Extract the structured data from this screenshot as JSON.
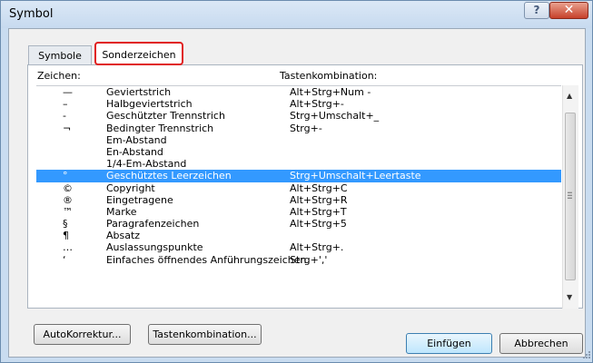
{
  "window": {
    "title": "Symbol",
    "help_label": "?",
    "close_label": "✕"
  },
  "tabs": {
    "symbole": "Symbole",
    "sonderzeichen": "Sonderzeichen"
  },
  "list": {
    "header_zeichen": "Zeichen:",
    "header_tasten": "Tastenkombination:",
    "rows": [
      {
        "char": "—",
        "name": "Geviertstrich",
        "keys": "Alt+Strg+Num -"
      },
      {
        "char": "–",
        "name": "Halbgeviertstrich",
        "keys": "Alt+Strg+-"
      },
      {
        "char": "-",
        "name": "Geschützter Trennstrich",
        "keys": "Strg+Umschalt+_"
      },
      {
        "char": "¬",
        "name": "Bedingter Trennstrich",
        "keys": "Strg+-"
      },
      {
        "char": "",
        "name": "Em-Abstand",
        "keys": ""
      },
      {
        "char": "",
        "name": "En-Abstand",
        "keys": ""
      },
      {
        "char": "",
        "name": "1/4-Em-Abstand",
        "keys": ""
      },
      {
        "char": "°",
        "name": "Geschütztes Leerzeichen",
        "keys": "Strg+Umschalt+Leertaste",
        "selected": true
      },
      {
        "char": "©",
        "name": "Copyright",
        "keys": "Alt+Strg+C"
      },
      {
        "char": "®",
        "name": "Eingetragene",
        "keys": "Alt+Strg+R"
      },
      {
        "char": "™",
        "name": "Marke",
        "keys": "Alt+Strg+T"
      },
      {
        "char": "§",
        "name": "Paragrafenzeichen",
        "keys": "Alt+Strg+5"
      },
      {
        "char": "¶",
        "name": "Absatz",
        "keys": ""
      },
      {
        "char": "…",
        "name": "Auslassungspunkte",
        "keys": "Alt+Strg+."
      },
      {
        "char": "‘",
        "name": "Einfaches öffnendes Anführungszeichen",
        "keys": "Strg+','"
      }
    ]
  },
  "buttons": {
    "autokorrektur": "AutoKorrektur...",
    "tastenkombination": "Tastenkombination...",
    "einfuegen": "Einfügen",
    "abbrechen": "Abbrechen"
  },
  "colors": {
    "selection": "#3399ff",
    "highlight_border": "#e01e1e"
  }
}
